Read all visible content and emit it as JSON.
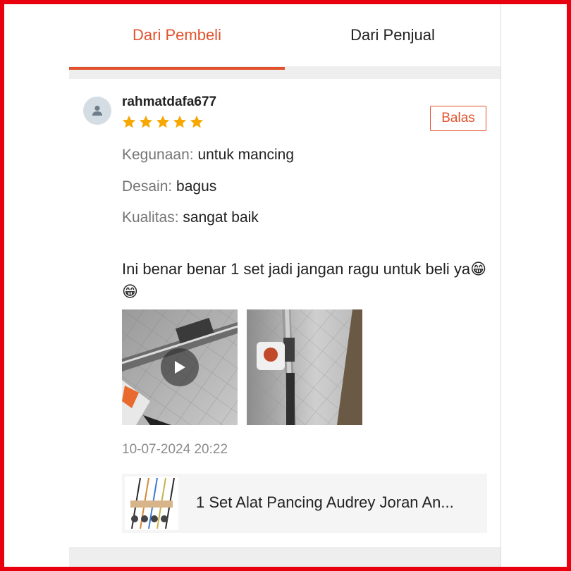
{
  "tabs": [
    {
      "label": "Dari Pembeli",
      "active": true
    },
    {
      "label": "Dari Penjual",
      "active": false
    }
  ],
  "review": {
    "username": "rahmatdafa677",
    "rating": 5,
    "reply_label": "Balas",
    "attributes": [
      {
        "key": "Kegunaan:",
        "value": "untuk mancing"
      },
      {
        "key": "Desain:",
        "value": "bagus"
      },
      {
        "key": "Kualitas:",
        "value": "sangat baik"
      }
    ],
    "text": "Ini benar benar 1 set jadi jangan ragu untuk beli ya😁😁",
    "timestamp": "10-07-2024 20:22"
  },
  "product": {
    "title": "1 Set Alat Pancing Audrey Joran An..."
  },
  "colors": {
    "accent": "#e2532d",
    "star": "#f6a700",
    "frame": "#e8000e"
  },
  "icons": {
    "avatar": "user-silhouette-icon",
    "star": "star-icon",
    "play": "play-icon"
  }
}
